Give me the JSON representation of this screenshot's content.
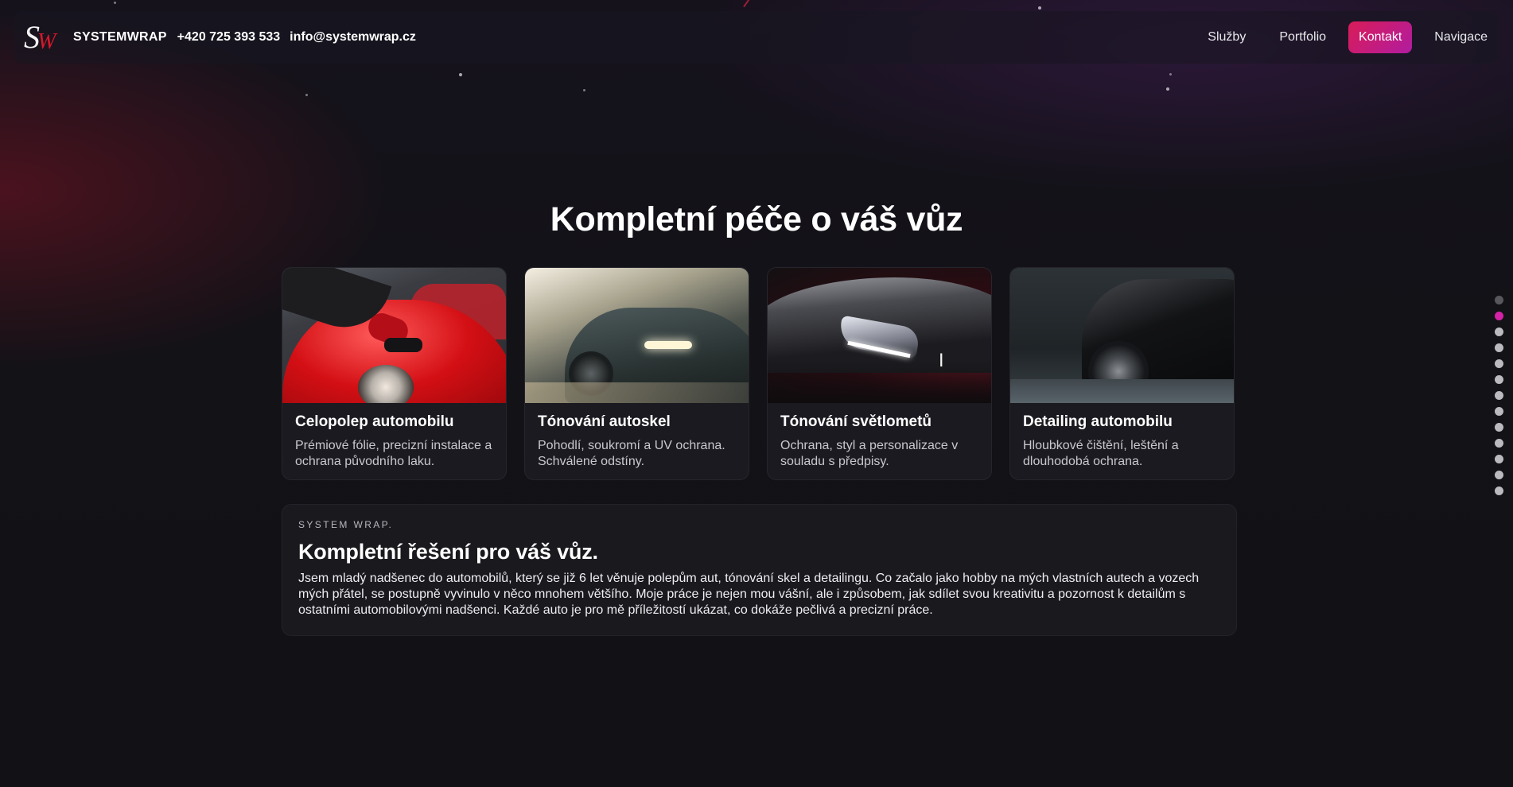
{
  "header": {
    "logo_text": "SW",
    "brand": "SYSTEMWRAP",
    "phone": "+420 725 393 533",
    "email": "info@systemwrap.cz"
  },
  "nav": [
    {
      "label": "Služby",
      "active": false
    },
    {
      "label": "Portfolio",
      "active": false
    },
    {
      "label": "Kontakt",
      "active": true
    },
    {
      "label": "Navigace",
      "active": false
    }
  ],
  "main": {
    "title": "Kompletní péče o váš vůz",
    "cards": [
      {
        "title": "Celopolep automobilu",
        "text": "Prémiové fólie, precizní instalace a ochrana původního laku."
      },
      {
        "title": "Tónování autoskel",
        "text": "Pohodlí, soukromí a UV ochrana. Schválené odstíny."
      },
      {
        "title": "Tónování světlometů",
        "text": "Ochrana, styl a personalizace v souladu s předpisy."
      },
      {
        "title": "Detailing automobilu",
        "text": "Hloubkové čištění, leštění a dlouhodobá ochrana."
      }
    ]
  },
  "info": {
    "eyebrow": "SYSTEM WRAP.",
    "heading": "Kompletní řešení pro váš vůz.",
    "text": "Jsem mladý nadšenec do automobilů, který se již 6 let věnuje polepům aut, tónování skel a detailingu. Co začalo jako hobby na mých vlastních autech a vozech mých přátel, se postupně vyvinulo v něco mnohem většího. Moje práce je nejen mou vášní, ale i způsobem, jak sdílet svou kreativitu a pozornost k detailům s ostatními automobilovými nadšenci. Každé auto je pro mě příležitostí ukázat, co dokáže pečlivá a precizní práce."
  },
  "side_nav": {
    "count": 13,
    "active_index": 1
  },
  "colors": {
    "accent_from": "#d91c57",
    "accent_to": "#b11ca0",
    "logo_w": "#d7182a"
  }
}
